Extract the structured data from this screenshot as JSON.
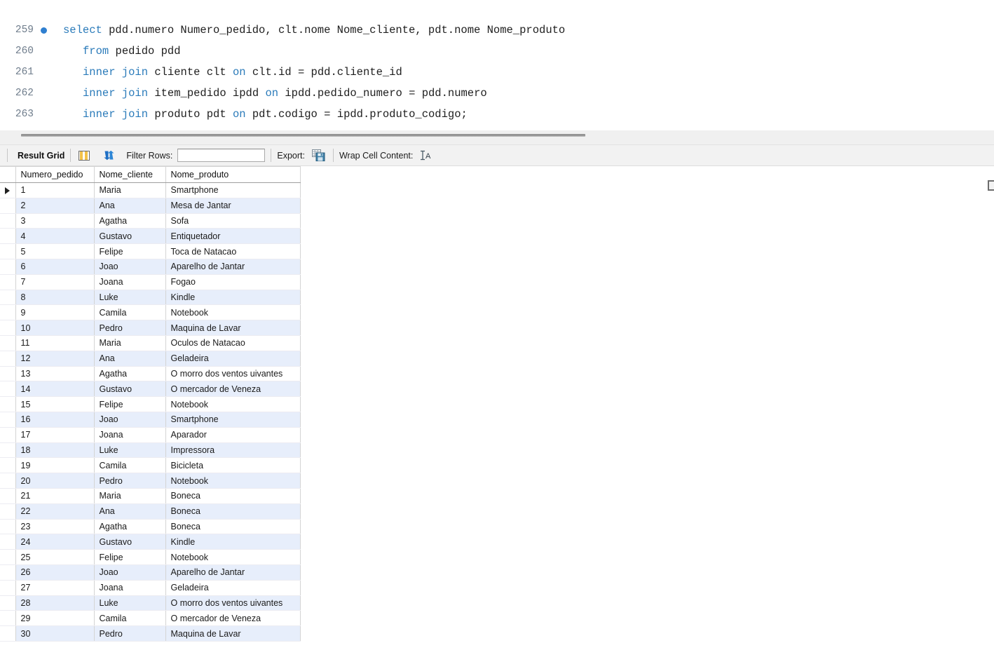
{
  "editor": {
    "lines": [
      {
        "number": "259",
        "has_marker": true,
        "indent": 0,
        "tokens": [
          {
            "t": "select",
            "kw": true
          },
          {
            "t": " pdd.numero Numero_pedido, clt.nome Nome_cliente, pdt.nome Nome_produto",
            "kw": false
          }
        ]
      },
      {
        "number": "260",
        "has_marker": false,
        "indent": 1,
        "tokens": [
          {
            "t": "from",
            "kw": true
          },
          {
            "t": " pedido pdd",
            "kw": false
          }
        ]
      },
      {
        "number": "261",
        "has_marker": false,
        "indent": 1,
        "tokens": [
          {
            "t": "inner join",
            "kw": true
          },
          {
            "t": " cliente clt ",
            "kw": false
          },
          {
            "t": "on",
            "kw": true
          },
          {
            "t": " clt.id = pdd.cliente_id",
            "kw": false
          }
        ]
      },
      {
        "number": "262",
        "has_marker": false,
        "indent": 1,
        "tokens": [
          {
            "t": "inner join",
            "kw": true
          },
          {
            "t": " item_pedido ipdd ",
            "kw": false
          },
          {
            "t": "on",
            "kw": true
          },
          {
            "t": " ipdd.pedido_numero = pdd.numero",
            "kw": false
          }
        ]
      },
      {
        "number": "263",
        "has_marker": false,
        "indent": 1,
        "tokens": [
          {
            "t": "inner join",
            "kw": true
          },
          {
            "t": " produto pdt ",
            "kw": false
          },
          {
            "t": "on",
            "kw": true
          },
          {
            "t": " pdt.codigo = ipdd.produto_codigo;",
            "kw": false
          }
        ]
      }
    ],
    "keyword_color": "#2b7bba",
    "text_color": "#1e1e1e",
    "gutter_color": "#6f7d8c",
    "marker_color": "#2f7fd0"
  },
  "toolbar": {
    "result_grid_label": "Result Grid",
    "grid_view_icon": "grid-view-icon",
    "refresh_icon": "refresh-icon",
    "filter_rows_label": "Filter Rows:",
    "filter_value": "",
    "filter_placeholder": "",
    "export_label": "Export:",
    "export_icon": "export-icon",
    "wrap_cell_label": "Wrap Cell Content:",
    "wrap_cell_icon": "wrap-text-icon"
  },
  "grid": {
    "columns": [
      "Numero_pedido",
      "Nome_cliente",
      "Nome_produto"
    ],
    "selected_row_index": 0,
    "row_marker_icon": "row-selector-arrow-icon",
    "alt_row_color": "#e7eefb",
    "rows": [
      [
        "1",
        "Maria",
        "Smartphone"
      ],
      [
        "2",
        "Ana",
        "Mesa de Jantar"
      ],
      [
        "3",
        "Agatha",
        "Sofa"
      ],
      [
        "4",
        "Gustavo",
        "Entiquetador"
      ],
      [
        "5",
        "Felipe",
        "Toca de Natacao"
      ],
      [
        "6",
        "Joao",
        "Aparelho de Jantar"
      ],
      [
        "7",
        "Joana",
        "Fogao"
      ],
      [
        "8",
        "Luke",
        "Kindle"
      ],
      [
        "9",
        "Camila",
        "Notebook"
      ],
      [
        "10",
        "Pedro",
        "Maquina de Lavar"
      ],
      [
        "11",
        "Maria",
        "Oculos de Natacao"
      ],
      [
        "12",
        "Ana",
        "Geladeira"
      ],
      [
        "13",
        "Agatha",
        "O morro dos ventos uivantes"
      ],
      [
        "14",
        "Gustavo",
        "O mercador de Veneza"
      ],
      [
        "15",
        "Felipe",
        "Notebook"
      ],
      [
        "16",
        "Joao",
        "Smartphone"
      ],
      [
        "17",
        "Joana",
        "Aparador"
      ],
      [
        "18",
        "Luke",
        "Impressora"
      ],
      [
        "19",
        "Camila",
        "Bicicleta"
      ],
      [
        "20",
        "Pedro",
        "Notebook"
      ],
      [
        "21",
        "Maria",
        "Boneca"
      ],
      [
        "22",
        "Ana",
        "Boneca"
      ],
      [
        "23",
        "Agatha",
        "Boneca"
      ],
      [
        "24",
        "Gustavo",
        "Kindle"
      ],
      [
        "25",
        "Felipe",
        "Notebook"
      ],
      [
        "26",
        "Joao",
        "Aparelho de Jantar"
      ],
      [
        "27",
        "Joana",
        "Geladeira"
      ],
      [
        "28",
        "Luke",
        "O morro dos ventos uivantes"
      ],
      [
        "29",
        "Camila",
        "O mercador de Veneza"
      ],
      [
        "30",
        "Pedro",
        "Maquina de Lavar"
      ]
    ]
  }
}
